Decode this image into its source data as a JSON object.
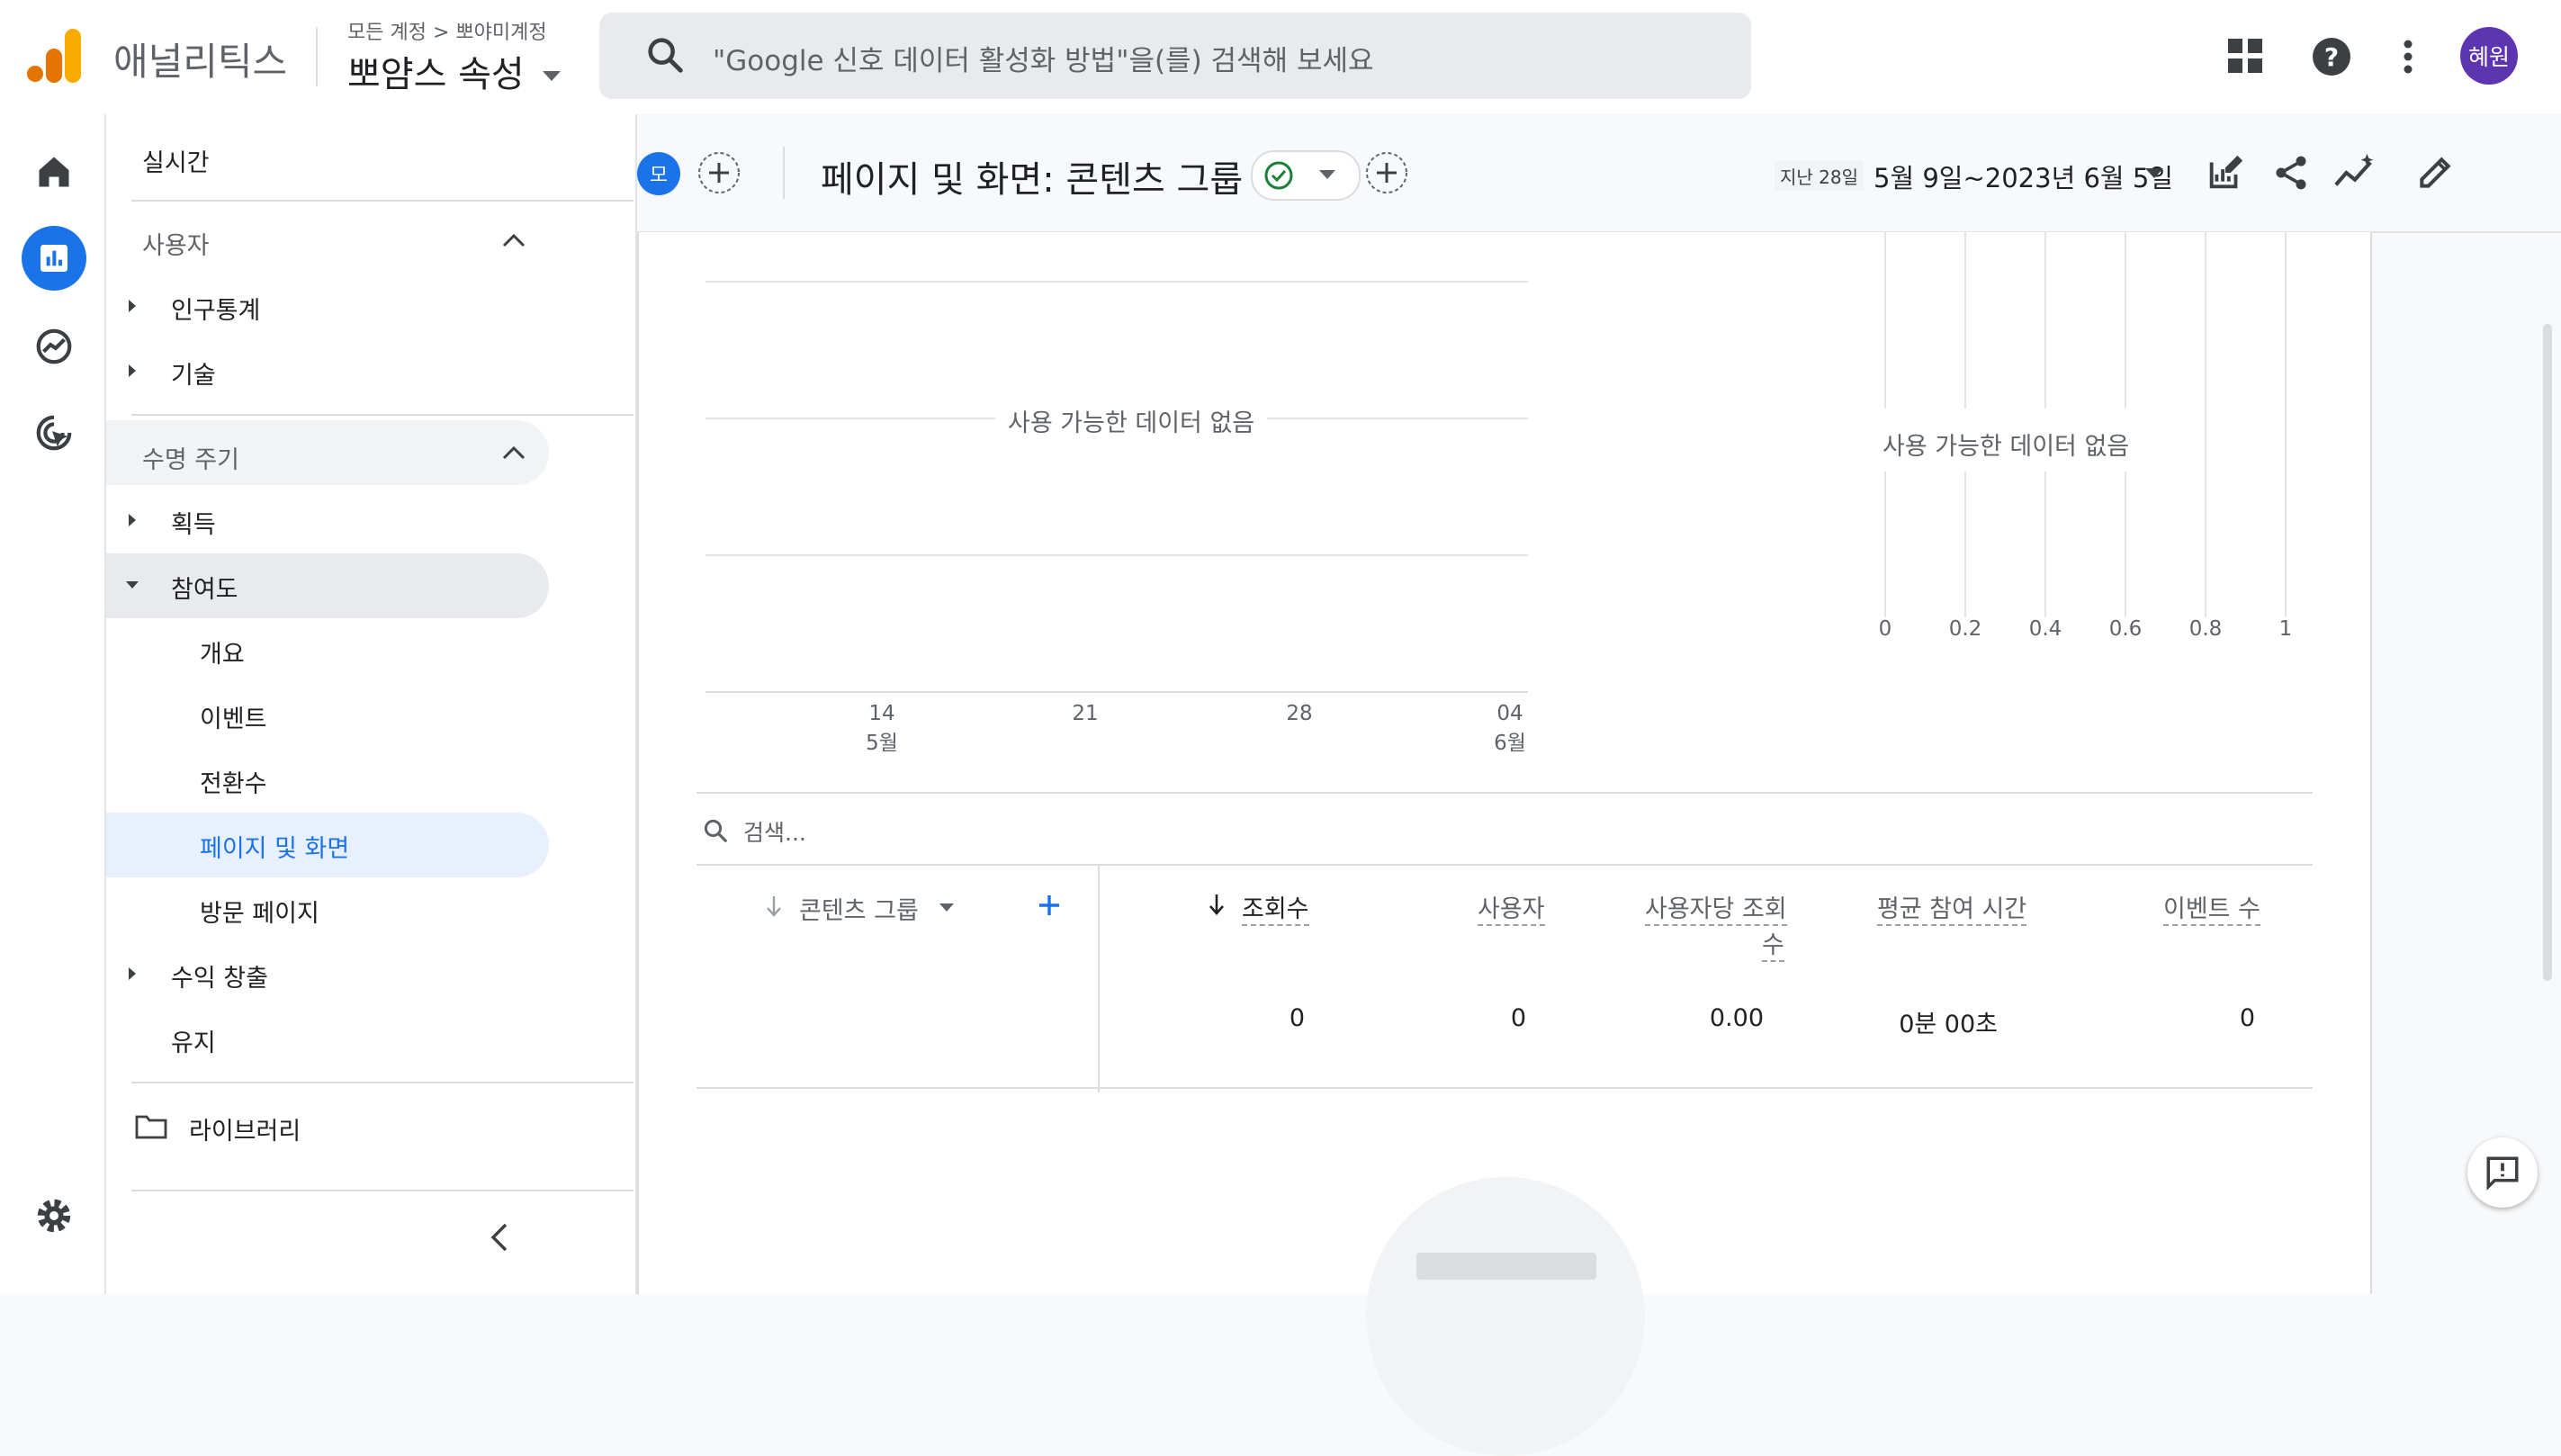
{
  "header": {
    "app_name": "애널리틱스",
    "breadcrumb": {
      "all_accounts": "모든 계정",
      "separator": ">",
      "account": "뽀야미계정"
    },
    "property": "뽀얌스 속성",
    "search_placeholder": "\"Google 신호 데이터 활성화 방법\"을(를) 검색해 보세요",
    "avatar_initials": "혜원",
    "icons": [
      "apps-grid-icon",
      "help-icon",
      "more-vert-icon"
    ]
  },
  "rail": {
    "icons": [
      "home-icon",
      "reports-icon",
      "explore-icon",
      "advertising-icon",
      "settings-icon"
    ],
    "active": "reports-icon"
  },
  "nav": {
    "realtime": "실시간",
    "user_section": "사용자",
    "demographics": "인구통계",
    "tech": "기술",
    "lifecycle_section": "수명 주기",
    "acquisition": "획득",
    "engagement": "참여도",
    "engagement_children": [
      "개요",
      "이벤트",
      "전환수",
      "페이지 및 화면",
      "방문 페이지"
    ],
    "monetization": "수익 창출",
    "retention": "유지",
    "library": "라이브러리",
    "active_item": "페이지 및 화면"
  },
  "toolbar": {
    "comparison_chip": "모",
    "title": "페이지 및 화면: 콘텐츠 그룹",
    "date_prefix": "지난 28일",
    "date_range": "5월 9일~2023년 6월 5일"
  },
  "charts": {
    "line_empty": "사용 가능한 데이터 없음",
    "bar_empty": "사용 가능한 데이터 없음",
    "line_x_ticks": [
      {
        "day": "14",
        "month": "5월"
      },
      {
        "day": "21",
        "month": ""
      },
      {
        "day": "28",
        "month": ""
      },
      {
        "day": "04",
        "month": "6월"
      }
    ],
    "bar_x_ticks": [
      "0",
      "0.2",
      "0.4",
      "0.6",
      "0.8",
      "1"
    ]
  },
  "table": {
    "search_placeholder": "검색...",
    "dimension_header": "콘텐츠 그룹",
    "columns": [
      "조회수",
      "사용자",
      "사용자당 조회",
      "평균 참여 시간",
      "이벤트 수"
    ],
    "col3_wrap": "수",
    "totals": [
      "0",
      "0",
      "0.00",
      "0분 00초",
      "0"
    ]
  },
  "colors": {
    "accent": "#1a73e8",
    "avatar": "#5e35b1",
    "check": "#188038",
    "logo_orange": "#f9ab00",
    "logo_dark": "#e37400"
  }
}
